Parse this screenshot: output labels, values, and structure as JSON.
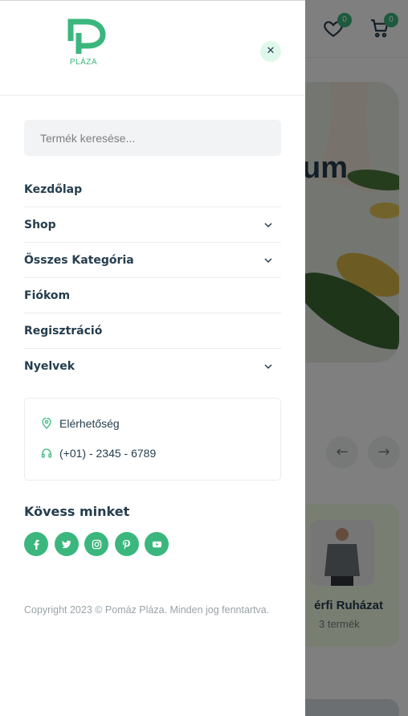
{
  "drawer": {
    "logo_text": "PLÁZA",
    "close_label": "✕",
    "search": {
      "placeholder": "Termék keresése..."
    },
    "menu": [
      {
        "label": "Kezdőlap",
        "has_submenu": false
      },
      {
        "label": "Shop",
        "has_submenu": true
      },
      {
        "label": "Összes Kategória",
        "has_submenu": true
      },
      {
        "label": "Fiókom",
        "has_submenu": false
      },
      {
        "label": "Regisztráció",
        "has_submenu": false
      },
      {
        "label": "Nyelvek",
        "has_submenu": true
      }
    ],
    "contact": {
      "location_label": "Elérhetőség",
      "phone": "(+01) - 2345 - 6789"
    },
    "follow_title": "Kövess minket",
    "socials": [
      "facebook-icon",
      "twitter-icon",
      "instagram-icon",
      "pinterest-icon",
      "youtube-icon"
    ],
    "copyright": "Copyright 2023 © Pomáz Pláza. Minden jog fenntartva."
  },
  "background": {
    "wishlist_count": "0",
    "cart_count": "0",
    "hero_text": "um",
    "card_title": "érfi Ruházat",
    "card_subtitle": "3 termék"
  },
  "colors": {
    "accent": "#3bb77e",
    "heading": "#253d4e",
    "muted": "#7e7e7e"
  }
}
